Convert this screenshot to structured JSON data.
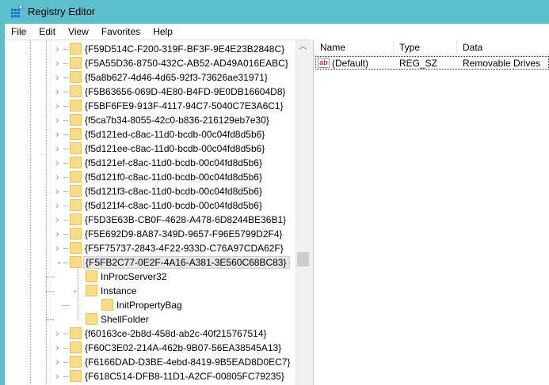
{
  "window": {
    "title": "Registry Editor",
    "accent": "#5bbfcc"
  },
  "menu": [
    "File",
    "Edit",
    "View",
    "Favorites",
    "Help"
  ],
  "tree": {
    "before": [
      "{F59D514C-F200-319F-BF3F-9E4E23B2848C}",
      "{F5A55D36-8750-432C-AB52-AD49A016EABC}",
      "{f5a8b627-4d46-4d65-92f3-73626ae31971}",
      "{F5B63656-069D-4E80-B4FD-9E0DB16604D8}",
      "{F5BF6FE9-913F-4117-94C7-5040C7E3A6C1}",
      "{f5ca7b34-8055-42c0-b836-216129eb7e30}",
      "{f5d121ed-c8ac-11d0-bcdb-00c04fd8d5b6}",
      "{f5d121ee-c8ac-11d0-bcdb-00c04fd8d5b6}",
      "{f5d121ef-c8ac-11d0-bcdb-00c04fd8d5b6}",
      "{f5d121f0-c8ac-11d0-bcdb-00c04fd8d5b6}",
      "{f5d121f3-c8ac-11d0-bcdb-00c04fd8d5b6}",
      "{f5d121f4-c8ac-11d0-bcdb-00c04fd8d5b6}",
      "{F5D3E63B-CB0F-4628-A478-6D8244BE36B1}",
      "{F5E692D9-8A87-349D-9657-F96E5799D2F4}",
      "{F5F75737-2843-4F22-933D-C76A97CDA62F}"
    ],
    "selected": "{F5FB2C77-0E2F-4A16-A381-3E560C68BC83}",
    "children": {
      "inproc": "InProcServer32",
      "instance": "Instance",
      "initbag": "InitPropertyBag",
      "shell": "ShellFolder"
    },
    "after": [
      "{f60163ce-2b8d-458d-ab2c-40f215767514}",
      "{F60C3E02-214A-462b-9B07-56EA38545A13}",
      "{F6166DAD-D3BE-4ebd-8419-9B5EAD8D0EC7}",
      "{F618C514-DFB8-11D1-A2CF-00805FC79235}"
    ]
  },
  "values": {
    "headers": {
      "name": "Name",
      "type": "Type",
      "data": "Data"
    },
    "rows": [
      {
        "name": "(Default)",
        "type": "REG_SZ",
        "data": "Removable Drives",
        "icon": "ab"
      }
    ]
  }
}
